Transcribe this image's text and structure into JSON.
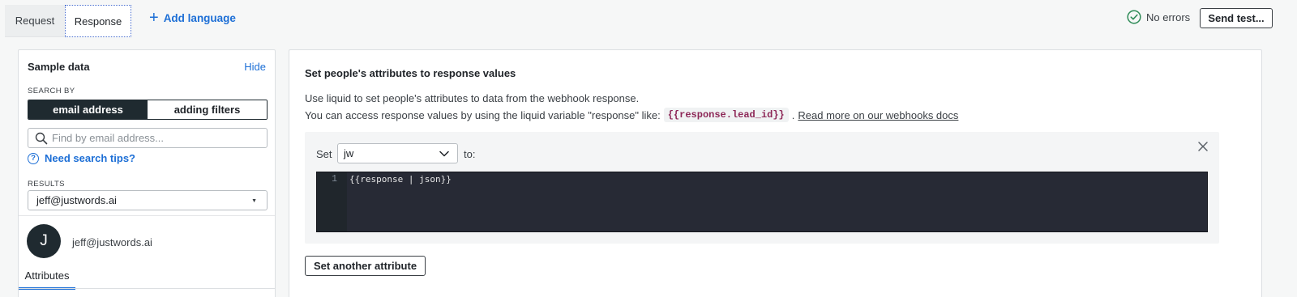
{
  "tabs": {
    "request": "Request",
    "response": "Response",
    "add_language": "Add language"
  },
  "status": {
    "no_errors": "No errors",
    "send_test": "Send test..."
  },
  "sample_data": {
    "title": "Sample data",
    "hide": "Hide",
    "search_by_label": "SEARCH BY",
    "segment_active": "email address",
    "segment_inactive": "adding filters",
    "search_placeholder": "Find by email address...",
    "search_tips": "Need search tips?",
    "results_label": "RESULTS",
    "results_value": "jeff@justwords.ai",
    "avatar_initial": "J",
    "profile_email": "jeff@justwords.ai",
    "attributes_tab": "Attributes"
  },
  "response_panel": {
    "title": "Set people's attributes to response values",
    "desc_line1": "Use liquid to set people's attributes to data from the webhook response.",
    "desc_line2_prefix": "You can access response values by using the liquid variable \"response\" like:",
    "code_example": "{{response.lead_id}}",
    "desc_line2_sep": ".",
    "docs_link": "Read more on our webhooks docs",
    "set_label": "Set",
    "attribute_value": "jw",
    "to_label": "to:",
    "line_number": "1",
    "code_value": "{{response | json}}",
    "set_another": "Set another attribute"
  },
  "colors": {
    "accent": "#1d6fd6",
    "dark": "#1f2a30",
    "editor_bg": "#272a35",
    "success": "#2e8b57",
    "code_chip_text": "#8d2757"
  },
  "icons": {
    "add": "plus-icon",
    "status": "check-circle-icon",
    "search": "search-icon",
    "tips": "question-circle-icon",
    "results_caret": "caret-down-icon",
    "attribute_caret": "chevron-down-icon",
    "remove": "close-icon"
  }
}
